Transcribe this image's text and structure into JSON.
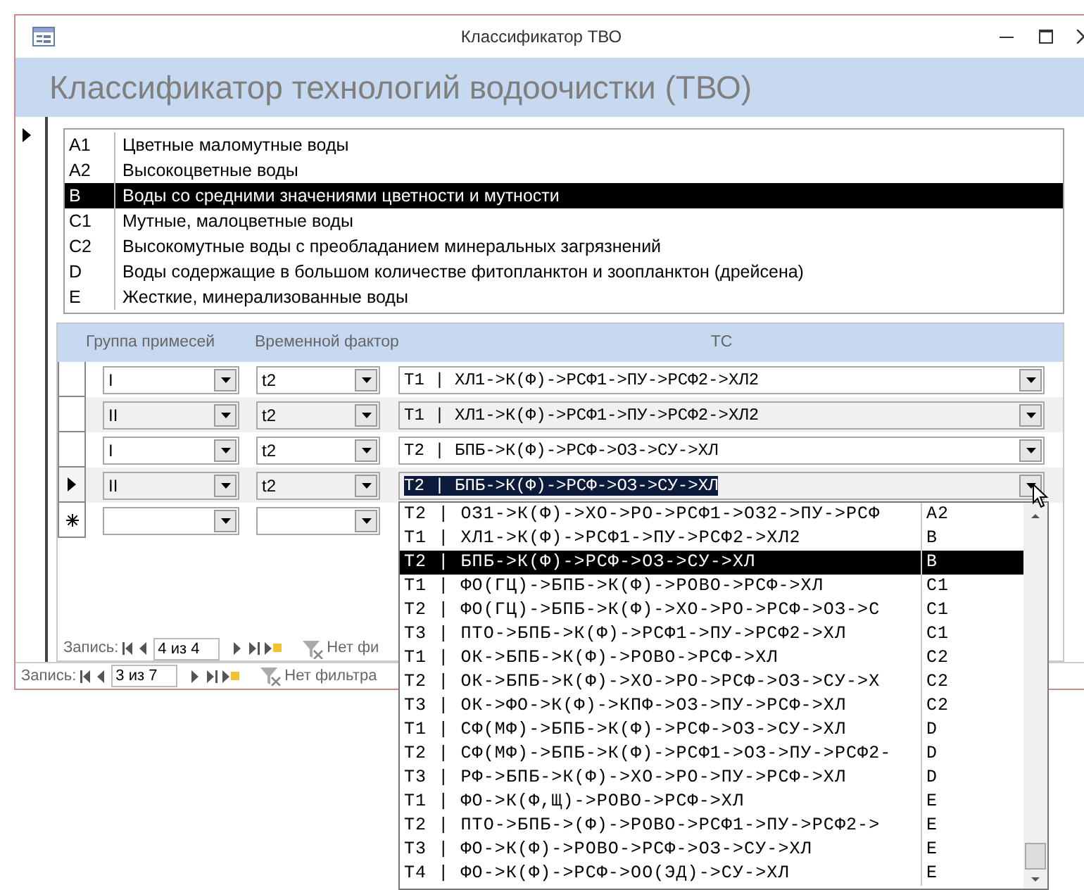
{
  "window": {
    "title": "Классификатор ТВО"
  },
  "header": {
    "title": "Классификатор технологий водоочистки (ТВО)"
  },
  "category_list": [
    {
      "code": "A1",
      "name": "Цветные маломутные воды",
      "selected": false
    },
    {
      "code": "A2",
      "name": "Высокоцветные воды",
      "selected": false
    },
    {
      "code": "B",
      "name": "Воды со средними значениями цветности и мутности",
      "selected": true
    },
    {
      "code": "C1",
      "name": "Мутные, малоцветные воды",
      "selected": false
    },
    {
      "code": "C2",
      "name": "Высокомутные воды с преобладанием минеральных загрязнений",
      "selected": false
    },
    {
      "code": "D",
      "name": "Воды содержащие в большом количестве фитопланктон и зоопланктон (дрейсена)",
      "selected": false
    },
    {
      "code": "E",
      "name": "Жесткие, минерализованные воды",
      "selected": false
    }
  ],
  "subform": {
    "columns": [
      "Группа примесей",
      "Временной фактор",
      "ТС"
    ],
    "rows": [
      {
        "kind": "record",
        "current": false,
        "group": "I",
        "time_factor": "t2",
        "tc": "T1 | ХЛ1->К(Ф)->РСФ1->ПУ->РСФ2->ХЛ2"
      },
      {
        "kind": "record",
        "current": false,
        "group": "II",
        "time_factor": "t2",
        "tc": "T1 | ХЛ1->К(Ф)->РСФ1->ПУ->РСФ2->ХЛ2"
      },
      {
        "kind": "record",
        "current": false,
        "group": "I",
        "time_factor": "t2",
        "tc": "T2 | БПБ->К(Ф)->РСФ->ОЗ->СУ->ХЛ"
      },
      {
        "kind": "record",
        "current": true,
        "group": "II",
        "time_factor": "t2",
        "tc": "T2 | БПБ->К(Ф)->РСФ->ОЗ->СУ->ХЛ"
      },
      {
        "kind": "new"
      }
    ],
    "navigation": {
      "label": "Запись:",
      "record": "4 из 4",
      "filter": "Нет фи"
    }
  },
  "navigation": {
    "label": "Запись:",
    "record": "3 из 7",
    "filter": "Нет фильтра"
  },
  "dropdown": [
    {
      "tc": "T2 | ОЗ1->К(Ф)->ХО->РО->РСФ1->ОЗ2->ПУ->РСФ",
      "code": "A2",
      "selected": false
    },
    {
      "tc": "T1 | ХЛ1->К(Ф)->РСФ1->ПУ->РСФ2->ХЛ2",
      "code": "B",
      "selected": false
    },
    {
      "tc": "T2 | БПБ->К(Ф)->РСФ->ОЗ->СУ->ХЛ",
      "code": "B",
      "selected": true
    },
    {
      "tc": "T1 | ФО(ГЦ)->БПБ->К(Ф)->РОВО->РСФ->ХЛ",
      "code": "C1",
      "selected": false
    },
    {
      "tc": "T2 | ФО(ГЦ)->БПБ->К(Ф)->ХО->РО->РСФ->ОЗ->С",
      "code": "C1",
      "selected": false
    },
    {
      "tc": "T3 | ПТО->БПБ->К(Ф)->РСФ1->ПУ->РСФ2->ХЛ",
      "code": "C1",
      "selected": false
    },
    {
      "tc": "T1 | ОК->БПБ->К(Ф)->РОВО->РСФ->ХЛ",
      "code": "C2",
      "selected": false
    },
    {
      "tc": "T2 | ОК->БПБ->К(Ф)->ХО->РО->РСФ->ОЗ->СУ->Х",
      "code": "C2",
      "selected": false
    },
    {
      "tc": "T3 | ОК->ФО->К(Ф)->КПФ->ОЗ->ПУ->РСФ->ХЛ",
      "code": "C2",
      "selected": false
    },
    {
      "tc": "T1 | СФ(МФ)->БПБ->К(Ф)->РСФ->ОЗ->СУ->ХЛ",
      "code": "D",
      "selected": false
    },
    {
      "tc": "T2 | СФ(МФ)->БПБ->К(Ф)->РСФ1->ОЗ->ПУ->РСФ2-",
      "code": "D",
      "selected": false
    },
    {
      "tc": "T3 | РФ->БПБ->К(Ф)->ХО->РО->ПУ->РСФ->ХЛ",
      "code": "D",
      "selected": false
    },
    {
      "tc": "T1 | ФО->К(Ф,Щ)->РОВО->РСФ->ХЛ",
      "code": "E",
      "selected": false
    },
    {
      "tc": "T2 | ПТО->БПБ->(Ф)->РОВО->РСФ1->ПУ->РСФ2->",
      "code": "E",
      "selected": false
    },
    {
      "tc": "T3 | ФО->К(Ф)->РОВО->РСФ->ОЗ->СУ->ХЛ",
      "code": "E",
      "selected": false
    },
    {
      "tc": "T4 | ФО->К(Ф)->РСФ->ОО(ЭД)->СУ->ХЛ",
      "code": "E",
      "selected": false
    }
  ]
}
